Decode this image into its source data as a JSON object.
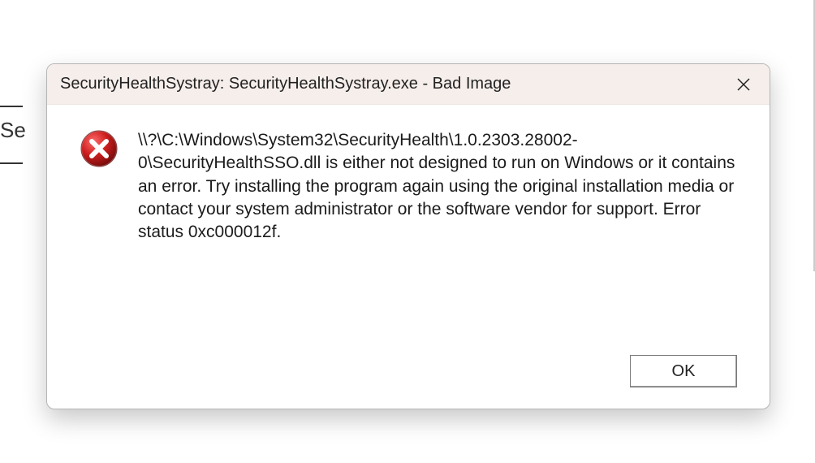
{
  "background": {
    "partial_text": "Se"
  },
  "dialog": {
    "title": "SecurityHealthSystray: SecurityHealthSystray.exe - Bad Image",
    "message": "\\\\?\\C:\\Windows\\System32\\SecurityHealth\\1.0.2303.28002-0\\SecurityHealthSSO.dll is either not designed to run on Windows or it contains an error. Try installing the program again using the original installation media or contact your system administrator or the software vendor for support. Error status 0xc000012f.",
    "ok_label": "OK",
    "icon": "error-icon"
  }
}
